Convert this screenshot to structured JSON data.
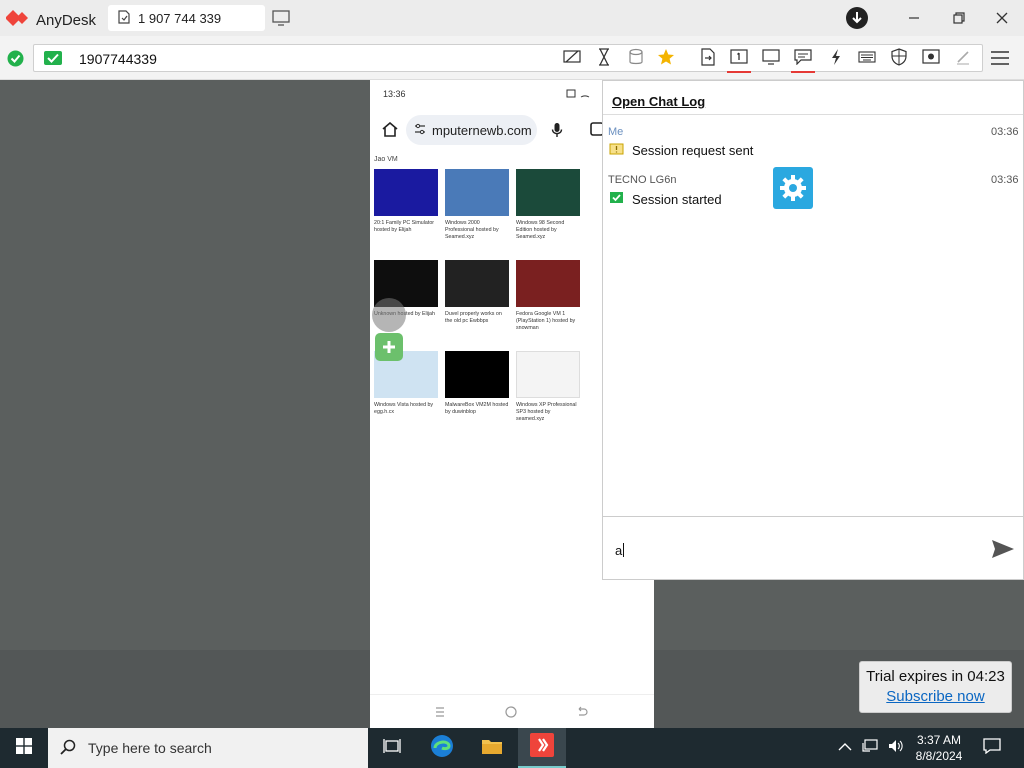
{
  "app": {
    "name": "AnyDesk",
    "tab_label": "1 907 744 339"
  },
  "address": {
    "value": "1907744339"
  },
  "phone": {
    "status_time": "13:36",
    "url": "mputernewb.com",
    "section_label": "Jao VM",
    "thumbs": [
      {
        "caption": "20:1 Family PC Simulator hosted by Elijah",
        "color": "#1a1aa0"
      },
      {
        "caption": "Windows 2000 Professional hosted by Seamed.xyz",
        "color": "#4a7ab8"
      },
      {
        "caption": "Windows 98 Second Edition hosted by Seamed.xyz",
        "color": "#1b4a3a"
      },
      {
        "caption": "Unknown hosted by Elijah",
        "color": "#0e0e0e"
      },
      {
        "caption": "Duvel properly works on the old pc Ewbbps",
        "color": "#222222"
      },
      {
        "caption": "Fedora Google VM 1 (PlayStation 1) hosted by snowman",
        "color": "#7a2020"
      },
      {
        "caption": "Windows Vista hosted by egg.h.cx",
        "color": "#cfe3f2"
      },
      {
        "caption": "MalwareBox VM2M hosted by duwinblop",
        "color": "#000000"
      },
      {
        "caption": "Windows XP Professional SP3 hosted by seamed.xyz",
        "color": "#f4f4f4"
      }
    ]
  },
  "chat": {
    "open_log": "Open Chat Log",
    "messages": [
      {
        "sender": "Me",
        "time": "03:36",
        "text": "Session request sent"
      },
      {
        "sender": "TECNO LG6n",
        "time": "03:36",
        "text": "Session started"
      }
    ],
    "input_value": "a"
  },
  "trial": {
    "text": "Trial expires in 04:23",
    "subscribe": "Subscribe now"
  },
  "taskbar": {
    "search_placeholder": "Type here to search",
    "time": "3:37 AM",
    "date": "8/8/2024"
  },
  "colors": {
    "anydesk_red": "#ef443b",
    "accent_green": "#22b14c",
    "link_blue": "#0a66c2"
  }
}
